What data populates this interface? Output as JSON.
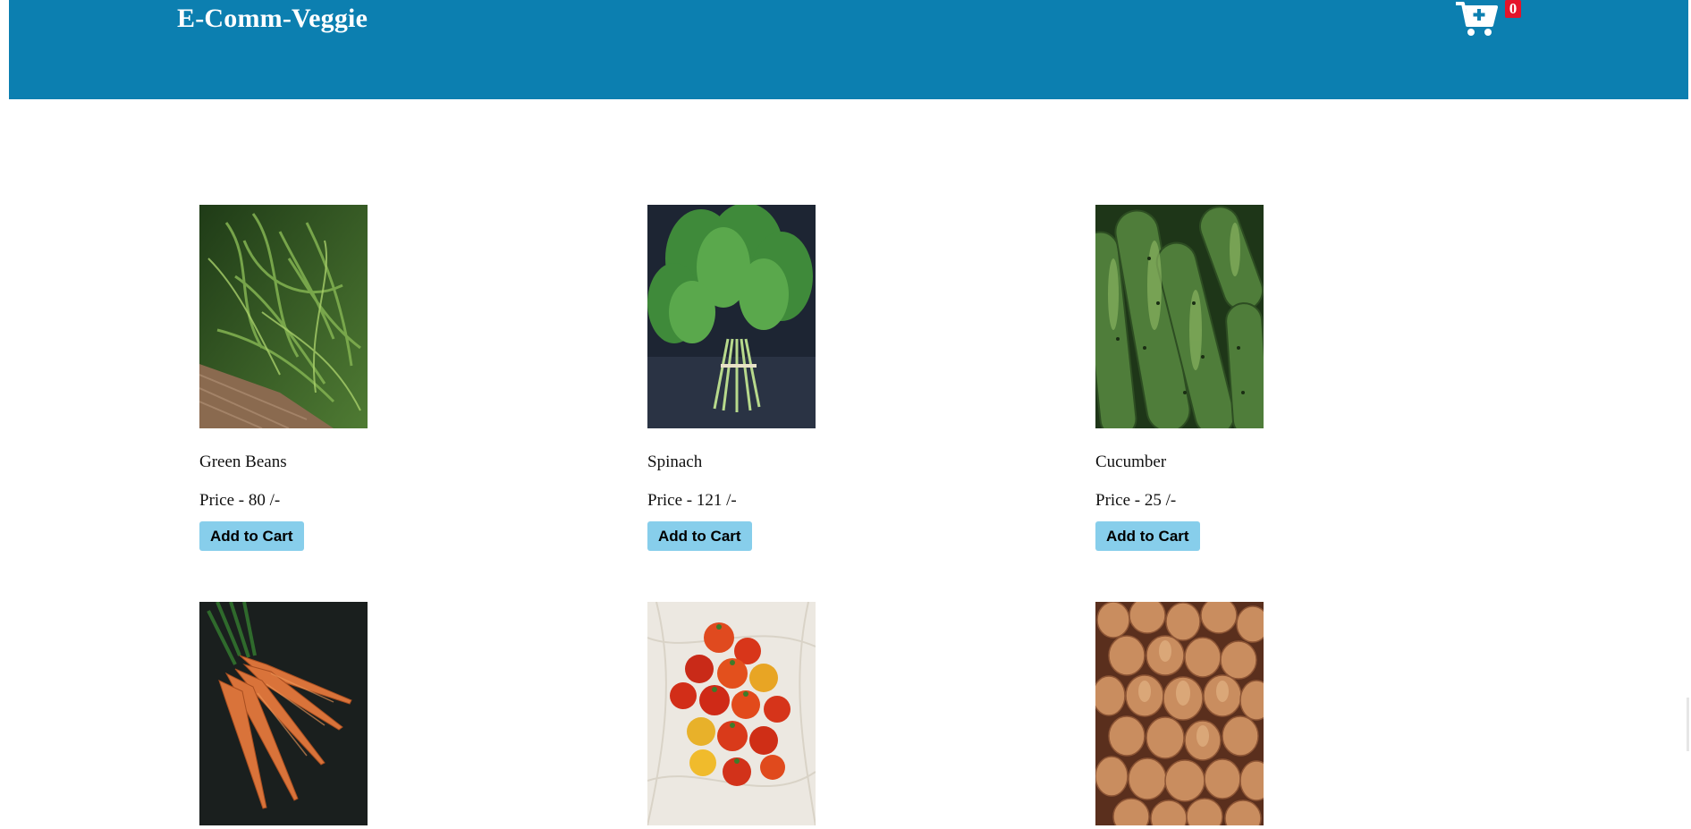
{
  "header": {
    "brand": "E-Comm-Veggie",
    "cart_count": "0",
    "cart_icon": "cart-plus-icon",
    "background_color": "#0c7fb0",
    "badge_color": "#e5132a"
  },
  "products": [
    {
      "name": "Green Beans",
      "price": "Price - 80 /-",
      "button": "Add to Cart",
      "image": "green-beans-image"
    },
    {
      "name": "Spinach",
      "price": "Price - 121 /-",
      "button": "Add to Cart",
      "image": "spinach-image"
    },
    {
      "name": "Cucumber",
      "price": "Price - 25 /-",
      "button": "Add to Cart",
      "image": "cucumber-image"
    },
    {
      "image": "carrots-image"
    },
    {
      "image": "tomatoes-image"
    },
    {
      "image": "onions-image"
    }
  ],
  "button_color": "#87ceeb"
}
